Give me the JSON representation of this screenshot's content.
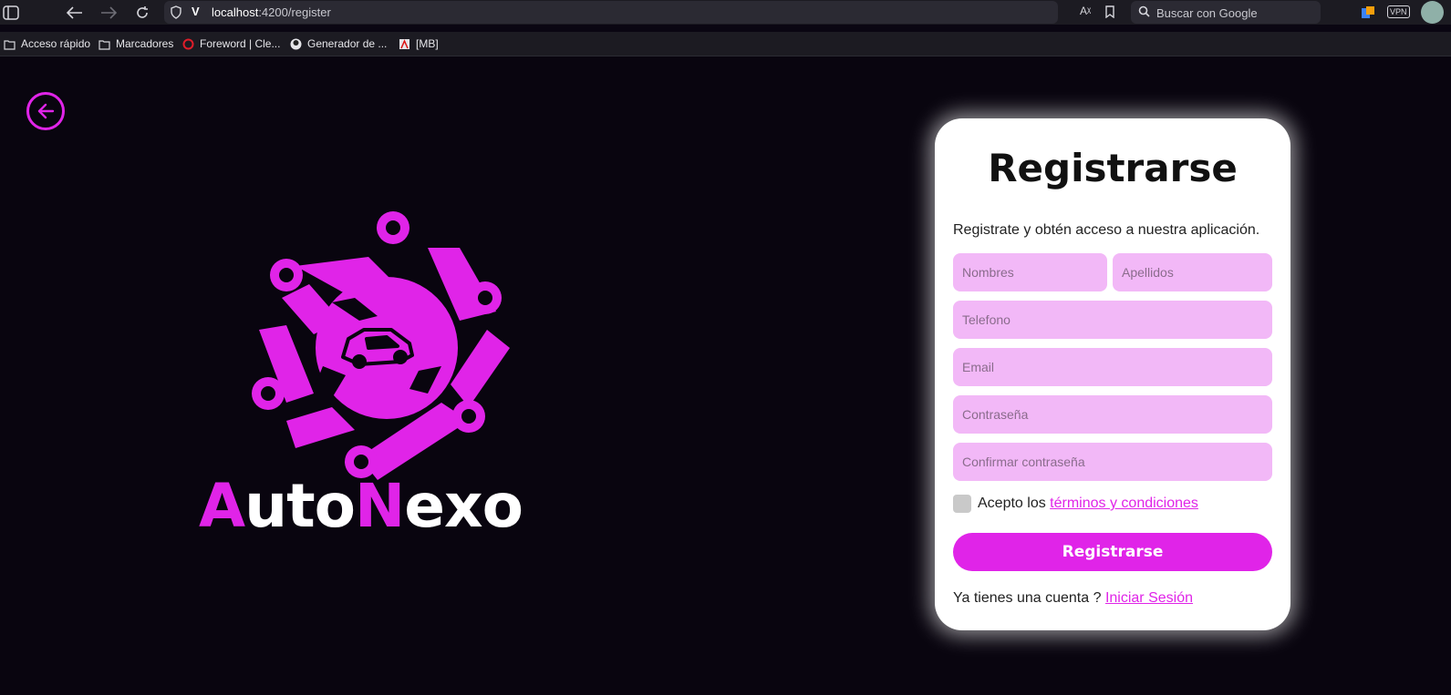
{
  "browser": {
    "url_host": "localhost",
    "url_path": ":4200/register",
    "search_placeholder": "Buscar con Google",
    "vpn_label": "VPN",
    "bookmarks": [
      {
        "label": "Acceso rápido",
        "icon": "folder-grid-icon"
      },
      {
        "label": "Marcadores",
        "icon": "folder-icon"
      },
      {
        "label": "Foreword | Cle...",
        "icon": "opera-icon"
      },
      {
        "label": "Generador de ...",
        "icon": "site-icon"
      },
      {
        "label": "[MB]",
        "icon": "site-icon"
      }
    ]
  },
  "brand": {
    "part1": "A",
    "part2": "uto",
    "part3": "N",
    "part4": "exo",
    "accent_color": "#e024e8"
  },
  "form": {
    "title": "Registrarse",
    "subtitle": "Registrate y obtén acceso a nuestra aplicación.",
    "fields": {
      "first_name": "Nombres",
      "last_name": "Apellidos",
      "phone": "Telefono",
      "email": "Email",
      "password": "Contraseña",
      "confirm_password": "Confirmar contraseña"
    },
    "terms_prefix": "Acepto los",
    "terms_link": "términos y condiciones",
    "submit_label": "Registrarse",
    "login_prompt": "Ya tienes una cuenta ?",
    "login_link": "Iniciar Sesión"
  }
}
